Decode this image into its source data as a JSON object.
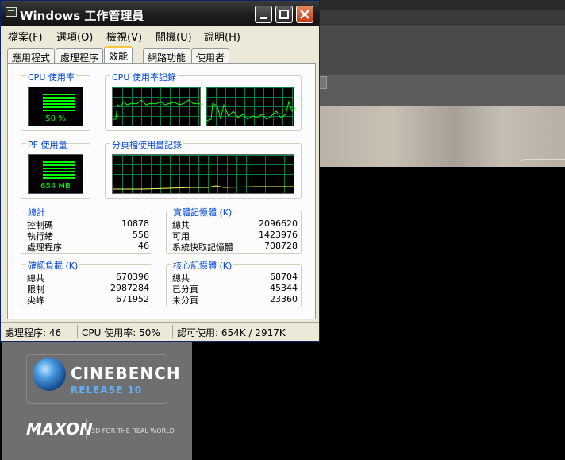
{
  "window": {
    "title": "Windows 工作管理員"
  },
  "menu": [
    "檔案(F)",
    "選項(O)",
    "檢視(V)",
    "關機(U)",
    "說明(H)"
  ],
  "tabs": [
    "應用程式",
    "處理程序",
    "效能",
    "網路功能",
    "使用者"
  ],
  "performance": {
    "cpu_usage": {
      "label": "CPU 使用率",
      "value": "50 %",
      "level": 0.5
    },
    "cpu_history": {
      "label": "CPU 使用率記錄"
    },
    "pf_usage": {
      "label": "PF 使用量",
      "value": "654 MB"
    },
    "pf_history": {
      "label": "分頁檔使用量記錄"
    },
    "totals": {
      "label": "總計",
      "rows": [
        {
          "k": "控制碼",
          "v": "10878"
        },
        {
          "k": "執行緒",
          "v": "558"
        },
        {
          "k": "處理程序",
          "v": "46"
        }
      ]
    },
    "physical": {
      "label": "實體記憶體 (K)",
      "rows": [
        {
          "k": "總共",
          "v": "2096620"
        },
        {
          "k": "可用",
          "v": "1423976"
        },
        {
          "k": "系統快取記憶體",
          "v": "708728"
        }
      ]
    },
    "commit": {
      "label": "確認負載 (K)",
      "rows": [
        {
          "k": "總共",
          "v": "670396"
        },
        {
          "k": "限制",
          "v": "2987284"
        },
        {
          "k": "尖峰",
          "v": "671952"
        }
      ]
    },
    "kernel": {
      "label": "核心記憶體 (K)",
      "rows": [
        {
          "k": "總共",
          "v": "68704"
        },
        {
          "k": "已分頁",
          "v": "45344"
        },
        {
          "k": "未分頁",
          "v": "23360"
        }
      ]
    }
  },
  "status": {
    "processes": "處理程序: 46",
    "cpu": "CPU 使用率: 50%",
    "commit": "認可使用: 654K / 2917K"
  },
  "background_app": {
    "title": "CINEBENCH",
    "release": "RELEASE 10",
    "brand": "MAXON",
    "slogan": "3D FOR THE REAL WORLD"
  }
}
